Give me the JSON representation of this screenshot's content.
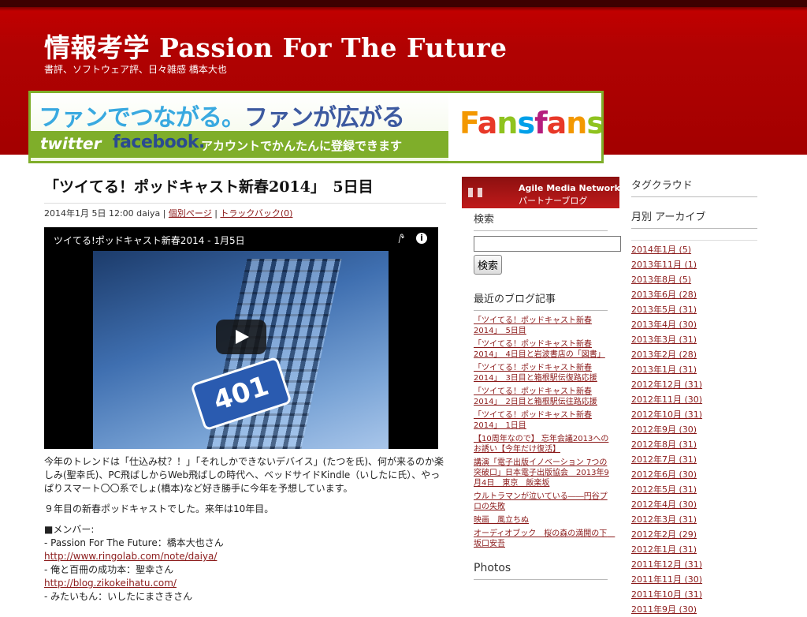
{
  "site": {
    "title": "情報考学 Passion For The Future",
    "description": "書評、ソフトウェア評、日々雑感 橋本大也"
  },
  "banner": {
    "line1_a": "ファンでつながる。",
    "line1_b": "ファンが広がる",
    "twitter": "twitter",
    "facebook": "facebook.",
    "line2": "アカウントでかんたんに登録できます",
    "logo_letters": [
      "F",
      "a",
      "n",
      "s",
      "f",
      "a",
      "n",
      "s"
    ]
  },
  "post": {
    "title": "「ツイてる！ポッドキャスト新春2014」　5日目",
    "meta_prefix": "2014年1月 5日 12:00 daiya |",
    "permalink": "個別ページ",
    "sep": "|",
    "trackback": "トラックバック(0)",
    "video": {
      "title": "ツイてる!ポッドキャスト新春2014 - 1月5日",
      "sign_text": "401"
    },
    "body": {
      "p1": "今年のトレンドは「仕込み杖？！」「それしかできないデバイス」(たつを氏)、何が来るのか楽しみ(聖幸氏)、PC飛ばしからWeb飛ばしの時代へ、ベッドサイドKindle（いしたに氏）、やっぱりスマート〇〇系でしょ(橋本)など好き勝手に今年を予想しています。",
      "p2": "９年目の新春ポッドキャストでした。来年は10年目。",
      "members_h": "■メンバー:",
      "m1": "- Passion For The Future：橋本大也さん",
      "m1_link": "http://www.ringolab.com/note/daiya/",
      "m2": "- 俺と百冊の成功本：聖幸さん",
      "m2_link": "http://blog.zikokeihatu.com/",
      "m3": "- みたいもん：いしたにまさきさん"
    }
  },
  "sidebar": {
    "amn_line1": "Agile Media Network",
    "amn_line2": "パートナーブログ",
    "search_heading": "検索",
    "search_value": "",
    "search_button": "検索",
    "recent_heading": "最近のブログ記事",
    "recent": [
      "「ツイてる！ポッドキャスト新春2014」　5日目",
      "「ツイてる！ポッドキャスト新春2014」　4日目と岩波書店の「図書」",
      "「ツイてる！ポッドキャスト新春2014」　3日目と箱根駅伝復路応援",
      "「ツイてる！ポッドキャスト新春2014」　2日目と箱根駅伝往路応援",
      "「ツイてる！ポッドキャスト新春2014」　1日目",
      "【10周年なので】 忘年会議2013へのお誘い【今年だけ復活】",
      "講演「電子出版イノベーション 7つの突破口」日本電子出版協会　2013年9月4日　東京　飯楽坂",
      "ウルトラマンが泣いている――円谷プロの失敗",
      "映画　風立ちぬ",
      "オーディオブック　桜の森の満開の下　坂口安吾"
    ],
    "photos_heading": "Photos"
  },
  "sidebar2": {
    "tagcloud_heading": "タグクラウド",
    "archive_heading": "月別 アーカイブ",
    "archives": [
      "2014年1月 (5)",
      "2013年11月 (1)",
      "2013年8月 (5)",
      "2013年6月 (28)",
      "2013年5月 (31)",
      "2013年4月 (30)",
      "2013年3月 (31)",
      "2013年2月 (28)",
      "2013年1月 (31)",
      "2012年12月 (31)",
      "2012年11月 (30)",
      "2012年10月 (31)",
      "2012年9月 (30)",
      "2012年8月 (31)",
      "2012年7月 (31)",
      "2012年6月 (30)",
      "2012年5月 (31)",
      "2012年4月 (30)",
      "2012年3月 (31)",
      "2012年2月 (29)",
      "2012年1月 (31)",
      "2011年12月 (31)",
      "2011年11月 (30)",
      "2011年10月 (31)",
      "2011年9月 (30)"
    ]
  },
  "colors": {
    "header_red": "#b10202",
    "link": "#8b1a1a",
    "banner_green": "#7fae2a"
  }
}
